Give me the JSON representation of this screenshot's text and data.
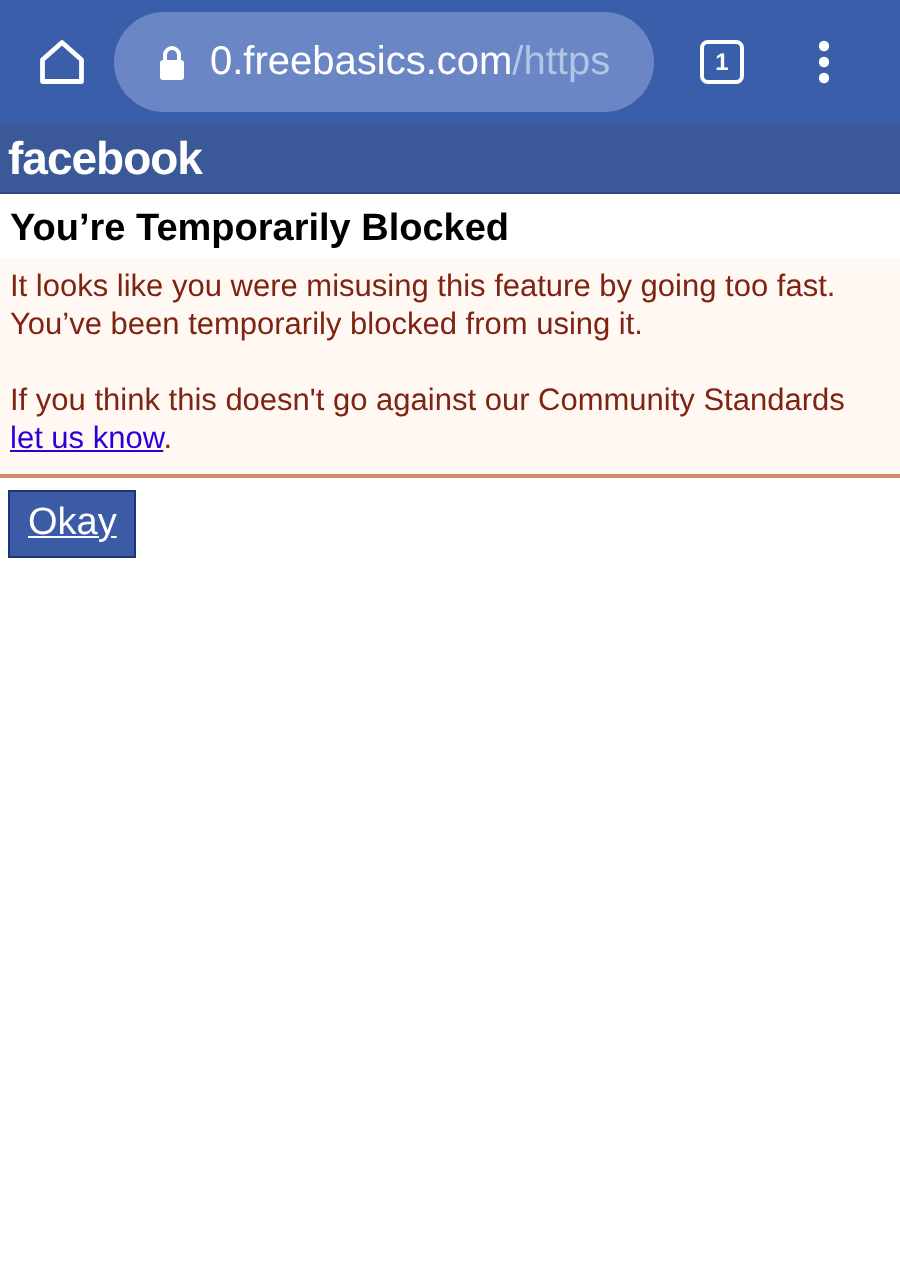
{
  "browser_bar": {
    "url_domain": "0.freebasics.com",
    "url_path": "/https",
    "tab_count": "1"
  },
  "header": {
    "logo": "facebook"
  },
  "title": "You’re Temporarily Blocked",
  "message": {
    "paragraphs": [
      "It looks like you were misusing this feature by going too fast. You’ve been temporarily blocked from using it.",
      "If you think this doesn't go against our Community Standards"
    ],
    "link": "let us know",
    "link_suffix": "."
  },
  "buttons": [
    {
      "label": "Okay"
    }
  ]
}
